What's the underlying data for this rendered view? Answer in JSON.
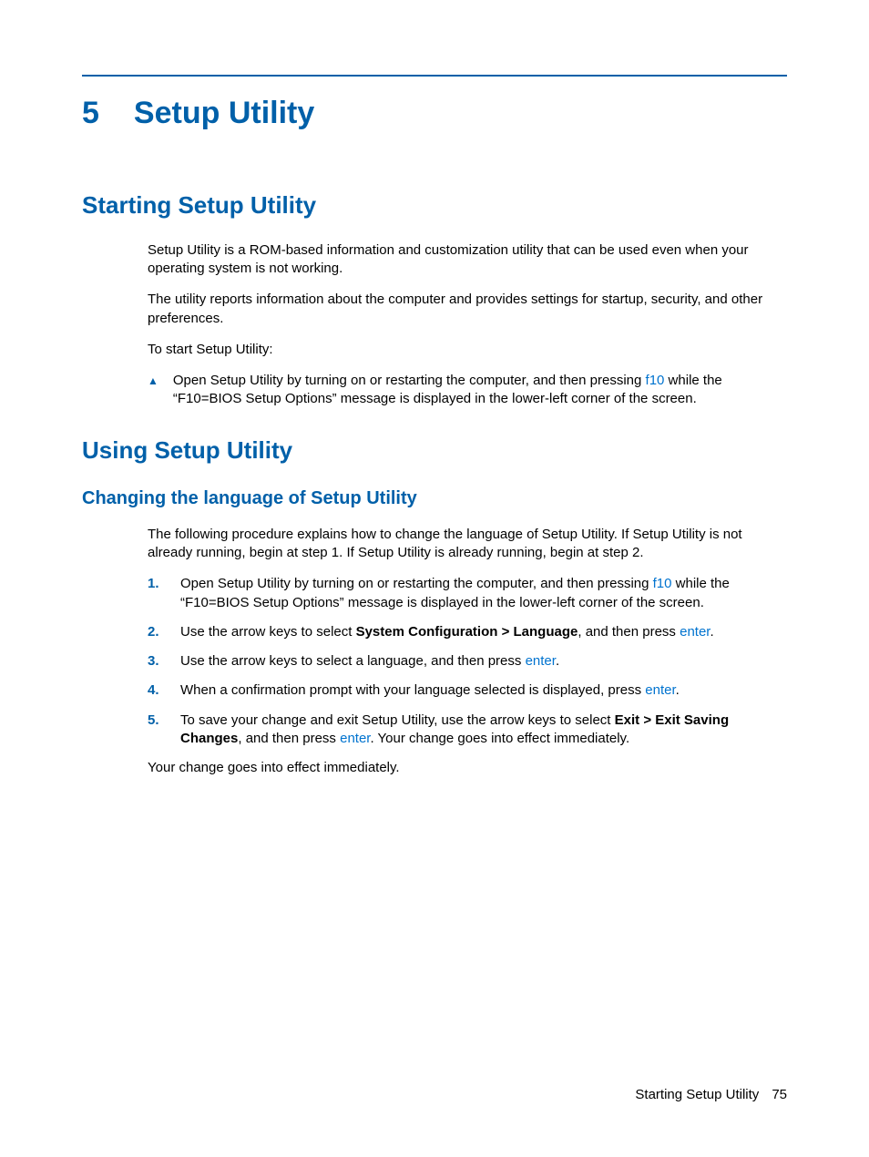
{
  "chapter": {
    "number": "5",
    "title": "Setup Utility"
  },
  "section1": {
    "heading": "Starting Setup Utility",
    "p1": "Setup Utility is a ROM-based information and customization utility that can be used even when your operating system is not working.",
    "p2": "The utility reports information about the computer and provides settings for startup, security, and other preferences.",
    "p3": "To start Setup Utility:",
    "bullet": {
      "a": "Open Setup Utility by turning on or restarting the computer, and then pressing ",
      "key": "f10",
      "b": " while the “F10=BIOS Setup Options” message is displayed in the lower-left corner of the screen."
    }
  },
  "section2": {
    "heading": "Using Setup Utility",
    "sub1": {
      "heading": "Changing the language of Setup Utility",
      "intro": "The following procedure explains how to change the language of Setup Utility. If Setup Utility is not already running, begin at step 1. If Setup Utility is already running, begin at step 2.",
      "steps": {
        "s1": {
          "num": "1.",
          "a": "Open Setup Utility by turning on or restarting the computer, and then pressing ",
          "key": "f10",
          "b": " while the “F10=BIOS Setup Options” message is displayed in the lower-left corner of the screen."
        },
        "s2": {
          "num": "2.",
          "a": "Use the arrow keys to select ",
          "bold": "System Configuration > Language",
          "b": ", and then press ",
          "key": "enter",
          "c": "."
        },
        "s3": {
          "num": "3.",
          "a": "Use the arrow keys to select a language, and then press ",
          "key": "enter",
          "b": "."
        },
        "s4": {
          "num": "4.",
          "a": "When a confirmation prompt with your language selected is displayed, press ",
          "key": "enter",
          "b": "."
        },
        "s5": {
          "num": "5.",
          "a": "To save your change and exit Setup Utility, use the arrow keys to select ",
          "bold": "Exit > Exit Saving Changes",
          "b": ", and then press ",
          "key": "enter",
          "c": ". Your change goes into effect immediately."
        }
      },
      "closing": "Your change goes into effect immediately."
    }
  },
  "footer": {
    "section": "Starting Setup Utility",
    "page": "75"
  }
}
